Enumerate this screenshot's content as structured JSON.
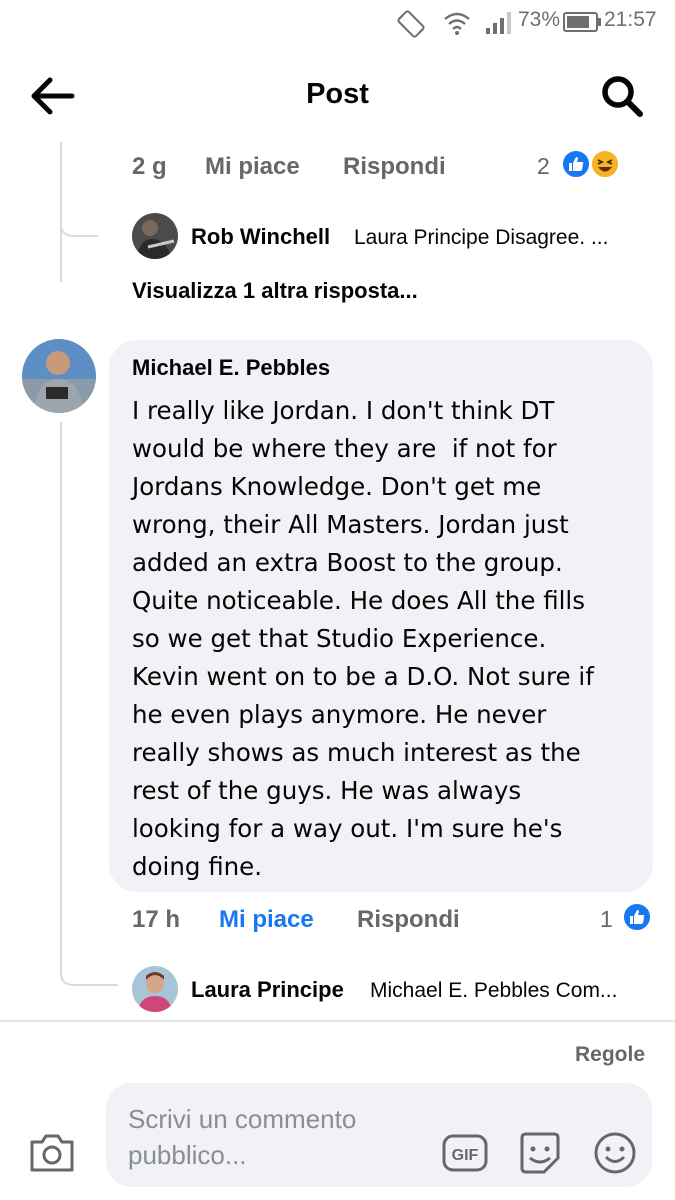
{
  "status_bar": {
    "battery": "73%",
    "time": "21:57"
  },
  "header": {
    "title": "Post"
  },
  "reply_meta_top": {
    "time": "2 g",
    "like": "Mi piace",
    "reply": "Rispondi",
    "reactions_count": "2"
  },
  "reply_preview_1": {
    "author": "Rob Winchell",
    "text": "Laura Principe Disagree. ..."
  },
  "view_more": "Visualizza 1 altra risposta...",
  "comment": {
    "author": "Michael E. Pebbles",
    "lines": [
      "I really like Jordan. I don't think DT",
      "would be where they are  if not for",
      "Jordans Knowledge. Don't get me",
      "wrong, their All Masters. Jordan just",
      "added an extra Boost to the group.",
      "Quite noticeable. He does All the fills",
      "so we get that Studio Experience.",
      "Kevin went on to be a D.O. Not sure if",
      "he even plays anymore. He never",
      "really shows as much interest as the",
      "rest of the guys. He was always",
      "looking for a way out. I'm sure he's",
      "doing fine."
    ],
    "time": "17 h",
    "like": "Mi piace",
    "reply": "Rispondi",
    "reactions_count": "1"
  },
  "reply_preview_2": {
    "author": "Laura Principe",
    "text": "Michael E. Pebbles Com..."
  },
  "footer": {
    "rules": "Regole",
    "placeholder_line1": "Scrivi un commento",
    "placeholder_line2": "pubblico...",
    "gif": "GIF"
  },
  "colors": {
    "accent": "#1877f2",
    "like_blue": "#1877f2",
    "haha_yellow": "#f7b125",
    "bubble_bg": "#f0f2f5"
  }
}
